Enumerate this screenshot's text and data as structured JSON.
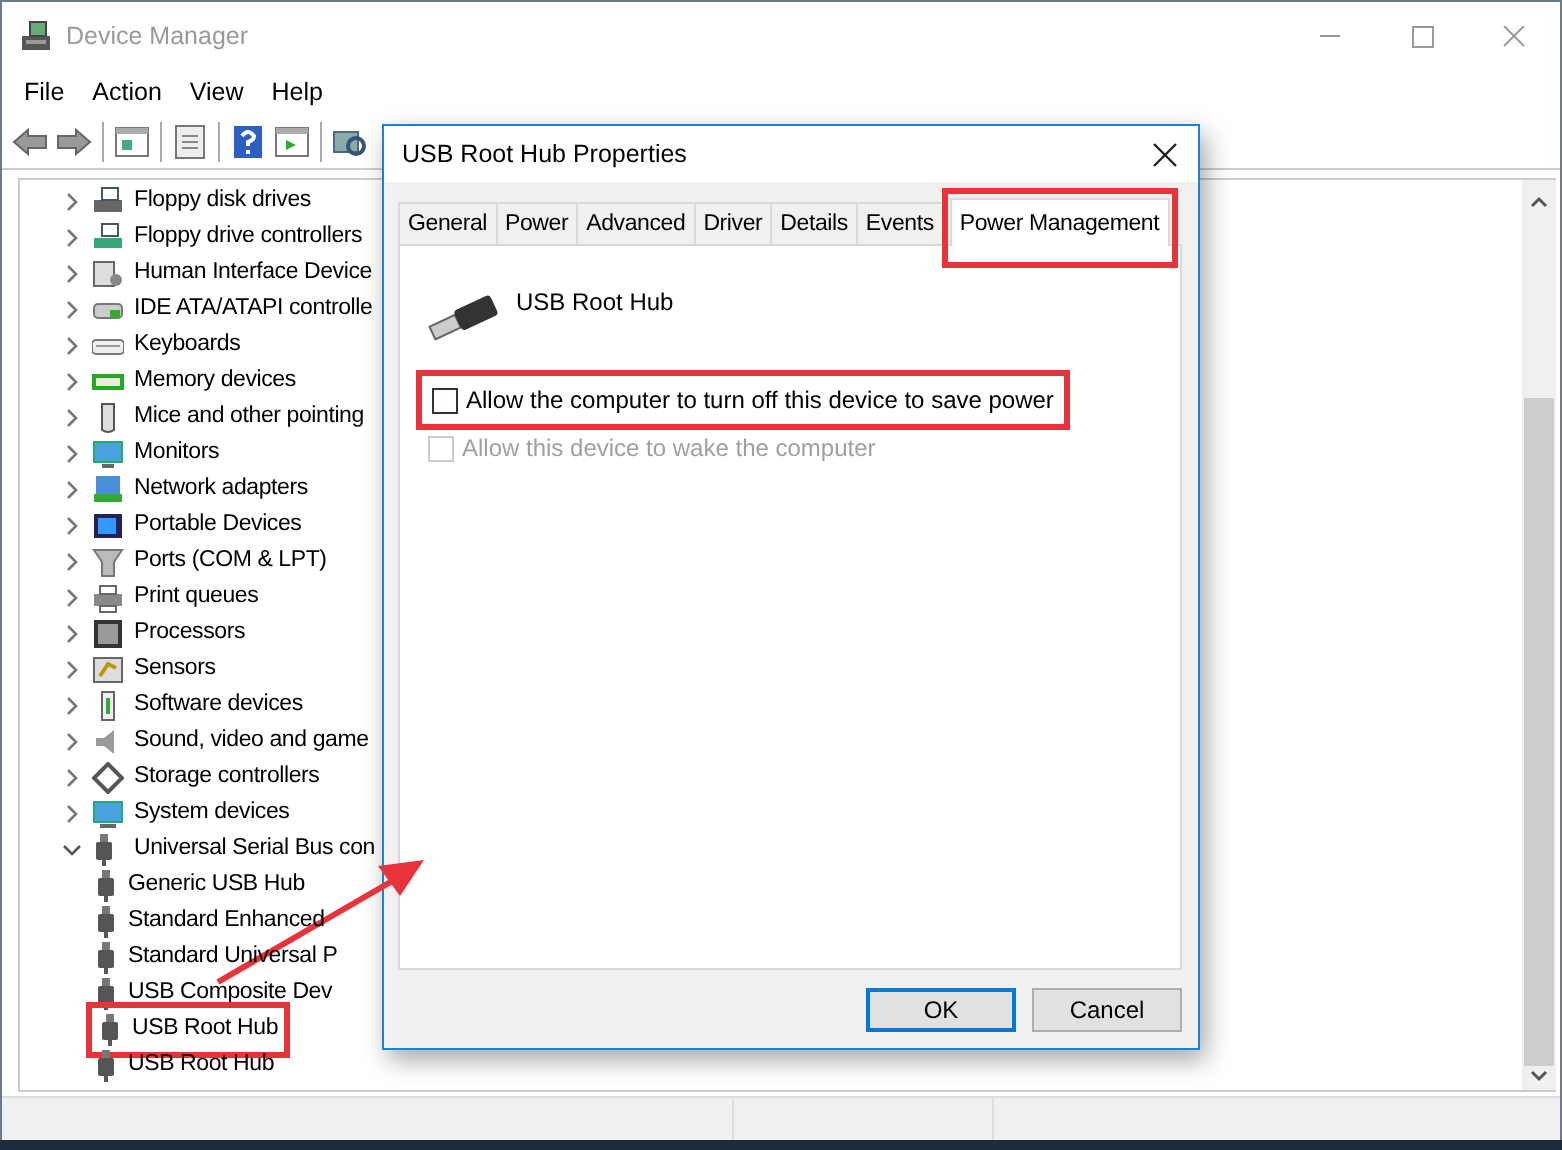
{
  "window": {
    "title": "Device Manager"
  },
  "menu": [
    "File",
    "Action",
    "View",
    "Help"
  ],
  "tree": [
    {
      "label": "Floppy disk drives",
      "expanded": false
    },
    {
      "label": "Floppy drive controllers",
      "expanded": false
    },
    {
      "label": "Human Interface Device",
      "expanded": false
    },
    {
      "label": "IDE ATA/ATAPI controlle",
      "expanded": false
    },
    {
      "label": "Keyboards",
      "expanded": false
    },
    {
      "label": "Memory devices",
      "expanded": false
    },
    {
      "label": "Mice and other pointing",
      "expanded": false
    },
    {
      "label": "Monitors",
      "expanded": false
    },
    {
      "label": "Network adapters",
      "expanded": false
    },
    {
      "label": "Portable Devices",
      "expanded": false
    },
    {
      "label": "Ports (COM & LPT)",
      "expanded": false
    },
    {
      "label": "Print queues",
      "expanded": false
    },
    {
      "label": "Processors",
      "expanded": false
    },
    {
      "label": "Sensors",
      "expanded": false
    },
    {
      "label": "Software devices",
      "expanded": false
    },
    {
      "label": "Sound, video and game",
      "expanded": false
    },
    {
      "label": "Storage controllers",
      "expanded": false
    },
    {
      "label": "System devices",
      "expanded": false
    },
    {
      "label": "Universal Serial Bus con",
      "expanded": true,
      "children": [
        {
          "label": "Generic USB Hub",
          "highlighted": false
        },
        {
          "label": "Standard Enhanced",
          "highlighted": false
        },
        {
          "label": "Standard Universal P",
          "highlighted": false
        },
        {
          "label": "USB Composite Dev",
          "highlighted": false
        },
        {
          "label": "USB Root Hub",
          "highlighted": true
        },
        {
          "label": "USB Root Hub",
          "highlighted": false
        }
      ]
    }
  ],
  "dialog": {
    "title": "USB Root Hub Properties",
    "tabs": [
      {
        "label": "General",
        "selected": false,
        "highlighted": false
      },
      {
        "label": "Power",
        "selected": false,
        "highlighted": false
      },
      {
        "label": "Advanced",
        "selected": false,
        "highlighted": false
      },
      {
        "label": "Driver",
        "selected": false,
        "highlighted": false
      },
      {
        "label": "Details",
        "selected": false,
        "highlighted": false
      },
      {
        "label": "Events",
        "selected": false,
        "highlighted": false
      },
      {
        "label": "Power Management",
        "selected": true,
        "highlighted": true
      }
    ],
    "device_name": "USB Root Hub",
    "options": [
      {
        "label": "Allow the computer to turn off this device to save power",
        "checked": false,
        "disabled": false,
        "highlighted": true
      },
      {
        "label": "Allow this device to wake the computer",
        "checked": false,
        "disabled": true,
        "highlighted": false
      }
    ],
    "buttons": [
      {
        "label": "OK",
        "default": true
      },
      {
        "label": "Cancel",
        "default": false
      }
    ]
  }
}
